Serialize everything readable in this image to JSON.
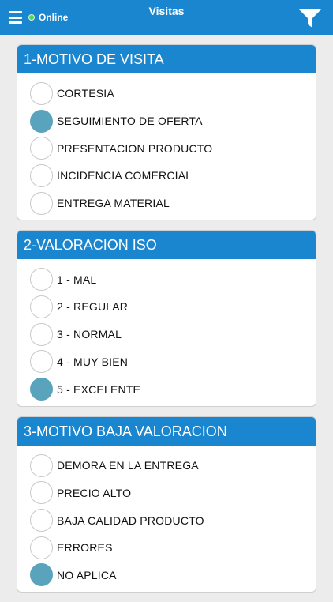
{
  "header": {
    "title": "Visitas",
    "status": "Online",
    "menu_icon": "hamburger-menu-icon",
    "filter_icon": "filter-icon"
  },
  "colors": {
    "accent": "#1a86d0",
    "selected": "#5aa3bc",
    "online": "#52d65a"
  },
  "sections": [
    {
      "title": "1-MOTIVO DE VISITA",
      "options": [
        {
          "label": "CORTESIA",
          "checked": false
        },
        {
          "label": "SEGUIMIENTO DE OFERTA",
          "checked": true
        },
        {
          "label": "PRESENTACION PRODUCTO",
          "checked": false
        },
        {
          "label": "INCIDENCIA COMERCIAL",
          "checked": false
        },
        {
          "label": "ENTREGA MATERIAL",
          "checked": false
        }
      ]
    },
    {
      "title": "2-VALORACION ISO",
      "options": [
        {
          "label": "1 - MAL",
          "checked": false
        },
        {
          "label": "2 - REGULAR",
          "checked": false
        },
        {
          "label": "3 - NORMAL",
          "checked": false
        },
        {
          "label": "4 - MUY BIEN",
          "checked": false
        },
        {
          "label": "5 - EXCELENTE",
          "checked": true
        }
      ]
    },
    {
      "title": "3-MOTIVO BAJA VALORACION",
      "options": [
        {
          "label": "DEMORA EN LA ENTREGA",
          "checked": false
        },
        {
          "label": "PRECIO ALTO",
          "checked": false
        },
        {
          "label": "BAJA CALIDAD PRODUCTO",
          "checked": false
        },
        {
          "label": "ERRORES",
          "checked": false
        },
        {
          "label": "NO APLICA",
          "checked": true
        }
      ]
    }
  ]
}
